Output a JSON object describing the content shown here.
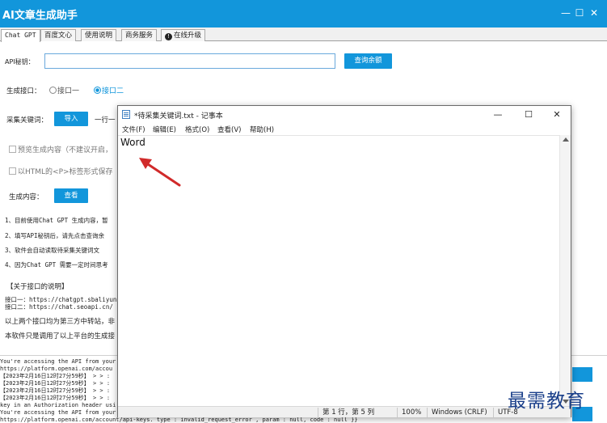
{
  "app": {
    "title": "AI文章生成助手",
    "accent_color": "#1296db",
    "window_buttons": {
      "minimize": "—",
      "maximize": "☐",
      "close": "✕"
    }
  },
  "tabs": [
    {
      "label": "Chat GPT",
      "active": true
    },
    {
      "label": "百度文心",
      "active": false
    },
    {
      "label": "使用说明",
      "active": false
    },
    {
      "label": "商务服务",
      "active": false
    },
    {
      "label": "在线升级",
      "active": false,
      "icon": "info-circle-icon"
    }
  ],
  "form": {
    "api_label": "API秘钥：",
    "api_value": "",
    "query_balance_label": "查询余额",
    "interface_label": "生成接口：",
    "interface_options": [
      "接口一",
      "接口二"
    ],
    "interface_selected": "接口二",
    "keyword_label": "采集关键词：",
    "import_label": "导入",
    "keyword_hint": "一行一",
    "preview_label": "预览生成内容（不建议开启，",
    "html_label": "以HTML的<P>标签形式保存",
    "content_label": "生成内容：",
    "view_label": "查看"
  },
  "notes": {
    "lines": [
      "1、目前使用Chat GPT 生成内容，暂",
      "2、填写API秘钥后，请先点击查询余",
      "3、软件会自动读取待采集关键词文",
      "4、因为Chat GPT 需要一定时间思考"
    ],
    "interface_heading": "【关于接口的说明】",
    "interface_lines": [
      "接口一：https://chatgpt.sbaliyun",
      "接口二：https://chat.seoapi.cn/"
    ],
    "relay_note": "以上两个接口均为第三方中转站，非",
    "platform_note": "本软件只是调用了以上平台的生成接"
  },
  "console": {
    "lines": [
      "You're accessing the API from your",
      "https://platform.openai.com/accou",
      "【2023年2月16日12时27分59秒】 > > :",
      "【2023年2月16日12时27分59秒】 > > :",
      "【2023年2月16日12时27分59秒】 > > :",
      "【2023年2月16日12时27分59秒】 > > :",
      "key in an Authorization header usi",
      "You're accessing the API from your",
      "https://platform.openai.com/account/api-keys.     type : invalid_request_error ,      param : null,      code : null   }}"
    ]
  },
  "notepad": {
    "title": "*待采集关键词.txt - 记事本",
    "window_buttons": {
      "minimize": "—",
      "maximize": "☐",
      "close": "✕"
    },
    "menu": [
      "文件(F)",
      "编辑(E)",
      "格式(O)",
      "查看(V)",
      "帮助(H)"
    ],
    "content": "Word",
    "status": {
      "position": "第 1 行，第 5 列",
      "zoom": "100%",
      "line_ending": "Windows (CRLF)",
      "encoding": "UTF-8"
    }
  },
  "annotation": {
    "arrow_color": "#d12a2a"
  },
  "watermark": {
    "text": "最需教育",
    "color": "#1a3f8a"
  }
}
